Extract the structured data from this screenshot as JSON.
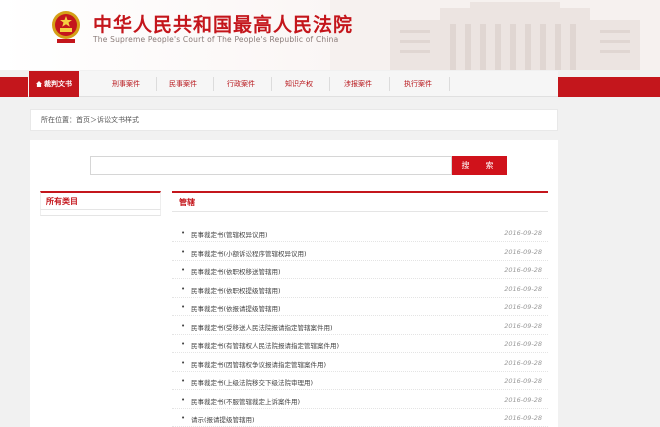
{
  "header": {
    "site_title": "中华人民共和国最高人民法院",
    "site_subtitle": "The Supreme People's Court of The People's Republic of China"
  },
  "nav": {
    "items": [
      {
        "label": "裁判文书",
        "active": true
      },
      {
        "label": "刑事案件",
        "active": false
      },
      {
        "label": "民事案件",
        "active": false
      },
      {
        "label": "行政案件",
        "active": false
      },
      {
        "label": "知识产权",
        "active": false
      },
      {
        "label": "涉报案件",
        "active": false
      },
      {
        "label": "执行案件",
        "active": false
      }
    ]
  },
  "breadcrumb": {
    "prefix": "所在位置：",
    "home": "首页",
    "separator": "＞",
    "current": "诉讼文书样式"
  },
  "search": {
    "placeholder": "",
    "button_label": "搜　索"
  },
  "sidebar": {
    "heading": "所有类目"
  },
  "content": {
    "heading": "管辖",
    "items": [
      {
        "title": "民事裁定书(管辖权异议用)",
        "date": "2016-09-28"
      },
      {
        "title": "民事裁定书(小额诉讼程序管辖权异议用)",
        "date": "2016-09-28"
      },
      {
        "title": "民事裁定书(依职权移送管辖用)",
        "date": "2016-09-28"
      },
      {
        "title": "民事裁定书(依职权提级管辖用)",
        "date": "2016-09-28"
      },
      {
        "title": "民事裁定书(依报请提级管辖用)",
        "date": "2016-09-28"
      },
      {
        "title": "民事裁定书(受移送人民法院报请指定管辖案件用)",
        "date": "2016-09-28"
      },
      {
        "title": "民事裁定书(有管辖权人民法院报请指定管辖案件用)",
        "date": "2016-09-28"
      },
      {
        "title": "民事裁定书(因管辖权争议报请指定管辖案件用)",
        "date": "2016-09-28"
      },
      {
        "title": "民事裁定书(上级法院移交下级法院审理用)",
        "date": "2016-09-28"
      },
      {
        "title": "民事裁定书(不服管辖裁定上诉案件用)",
        "date": "2016-09-28"
      },
      {
        "title": "请示(报请提级管辖用)",
        "date": "2016-09-28"
      }
    ]
  },
  "colors": {
    "brand_red": "#c4161c",
    "nav_text": "#b71318",
    "date_gray": "#9a9a9a"
  }
}
